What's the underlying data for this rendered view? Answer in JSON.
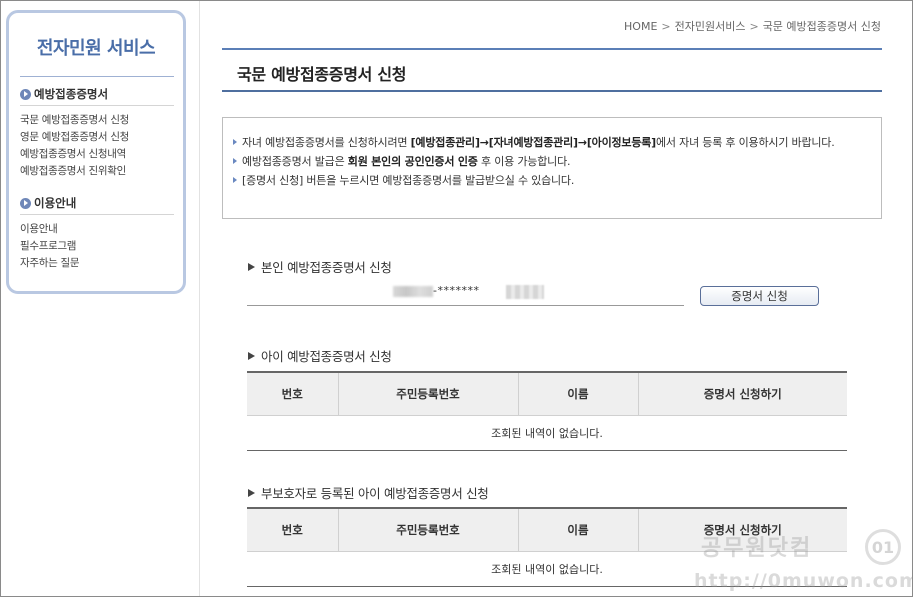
{
  "sidebar": {
    "title": "전자민원 서비스",
    "sections": [
      {
        "heading": "예방접종증명서",
        "links": [
          "국문 예방접종증명서 신청",
          "영문 예방접종증명서 신청",
          "예방접종증명서 신청내역",
          "예방접종증명서 진위확인"
        ]
      },
      {
        "heading": "이용안내",
        "links": [
          "이용안내",
          "필수프로그램",
          "자주하는 질문"
        ]
      }
    ]
  },
  "breadcrumb": [
    "HOME",
    "전자민원서비스",
    "국문 예방접종증명서 신청"
  ],
  "breadcrumb_sep": ">",
  "page_title": "국문 예방접종증명서 신청",
  "notice": {
    "line1_pre": "자녀 예방접종증명서를 신청하시려면 ",
    "line1_bold": "[예방접종관리]→[자녀예방접종관리]→[아이정보등록]",
    "line1_post": "에서 자녀 등록 후 이용하시기 바랍니다.",
    "line2_pre": "예방접종증명서 발급은 ",
    "line2_bold": "회원 본인의 공인인증서 인증",
    "line2_post": " 후 이용 가능합니다.",
    "line3": "[증명서 신청] 버튼을 누르시면 예방접종증명서를 발급받으실 수 있습니다."
  },
  "self_section": {
    "heading": "본인 예방접종증명서 신청",
    "masked_id": "-*******",
    "button_label": "증명서 신청"
  },
  "child_section": {
    "heading": "아이 예방접종증명서 신청",
    "columns": [
      "번호",
      "주민등록번호",
      "이름",
      "증명서 신청하기"
    ],
    "empty_text": "조회된 내역이 없습니다."
  },
  "guardian_section": {
    "heading": "부보호자로 등록된 아이 예방접종증명서 신청",
    "columns": [
      "번호",
      "주민등록번호",
      "이름",
      "증명서 신청하기"
    ],
    "empty_text": "조회된 내역이 없습니다."
  },
  "watermark": {
    "text": "공무원닷컴",
    "badge": "01",
    "url": "http://0muwon.com"
  },
  "colors": {
    "accent": "#4a6ea8",
    "sidebar_border": "#b9c8e2",
    "title_rule": "#5b7fb7"
  }
}
